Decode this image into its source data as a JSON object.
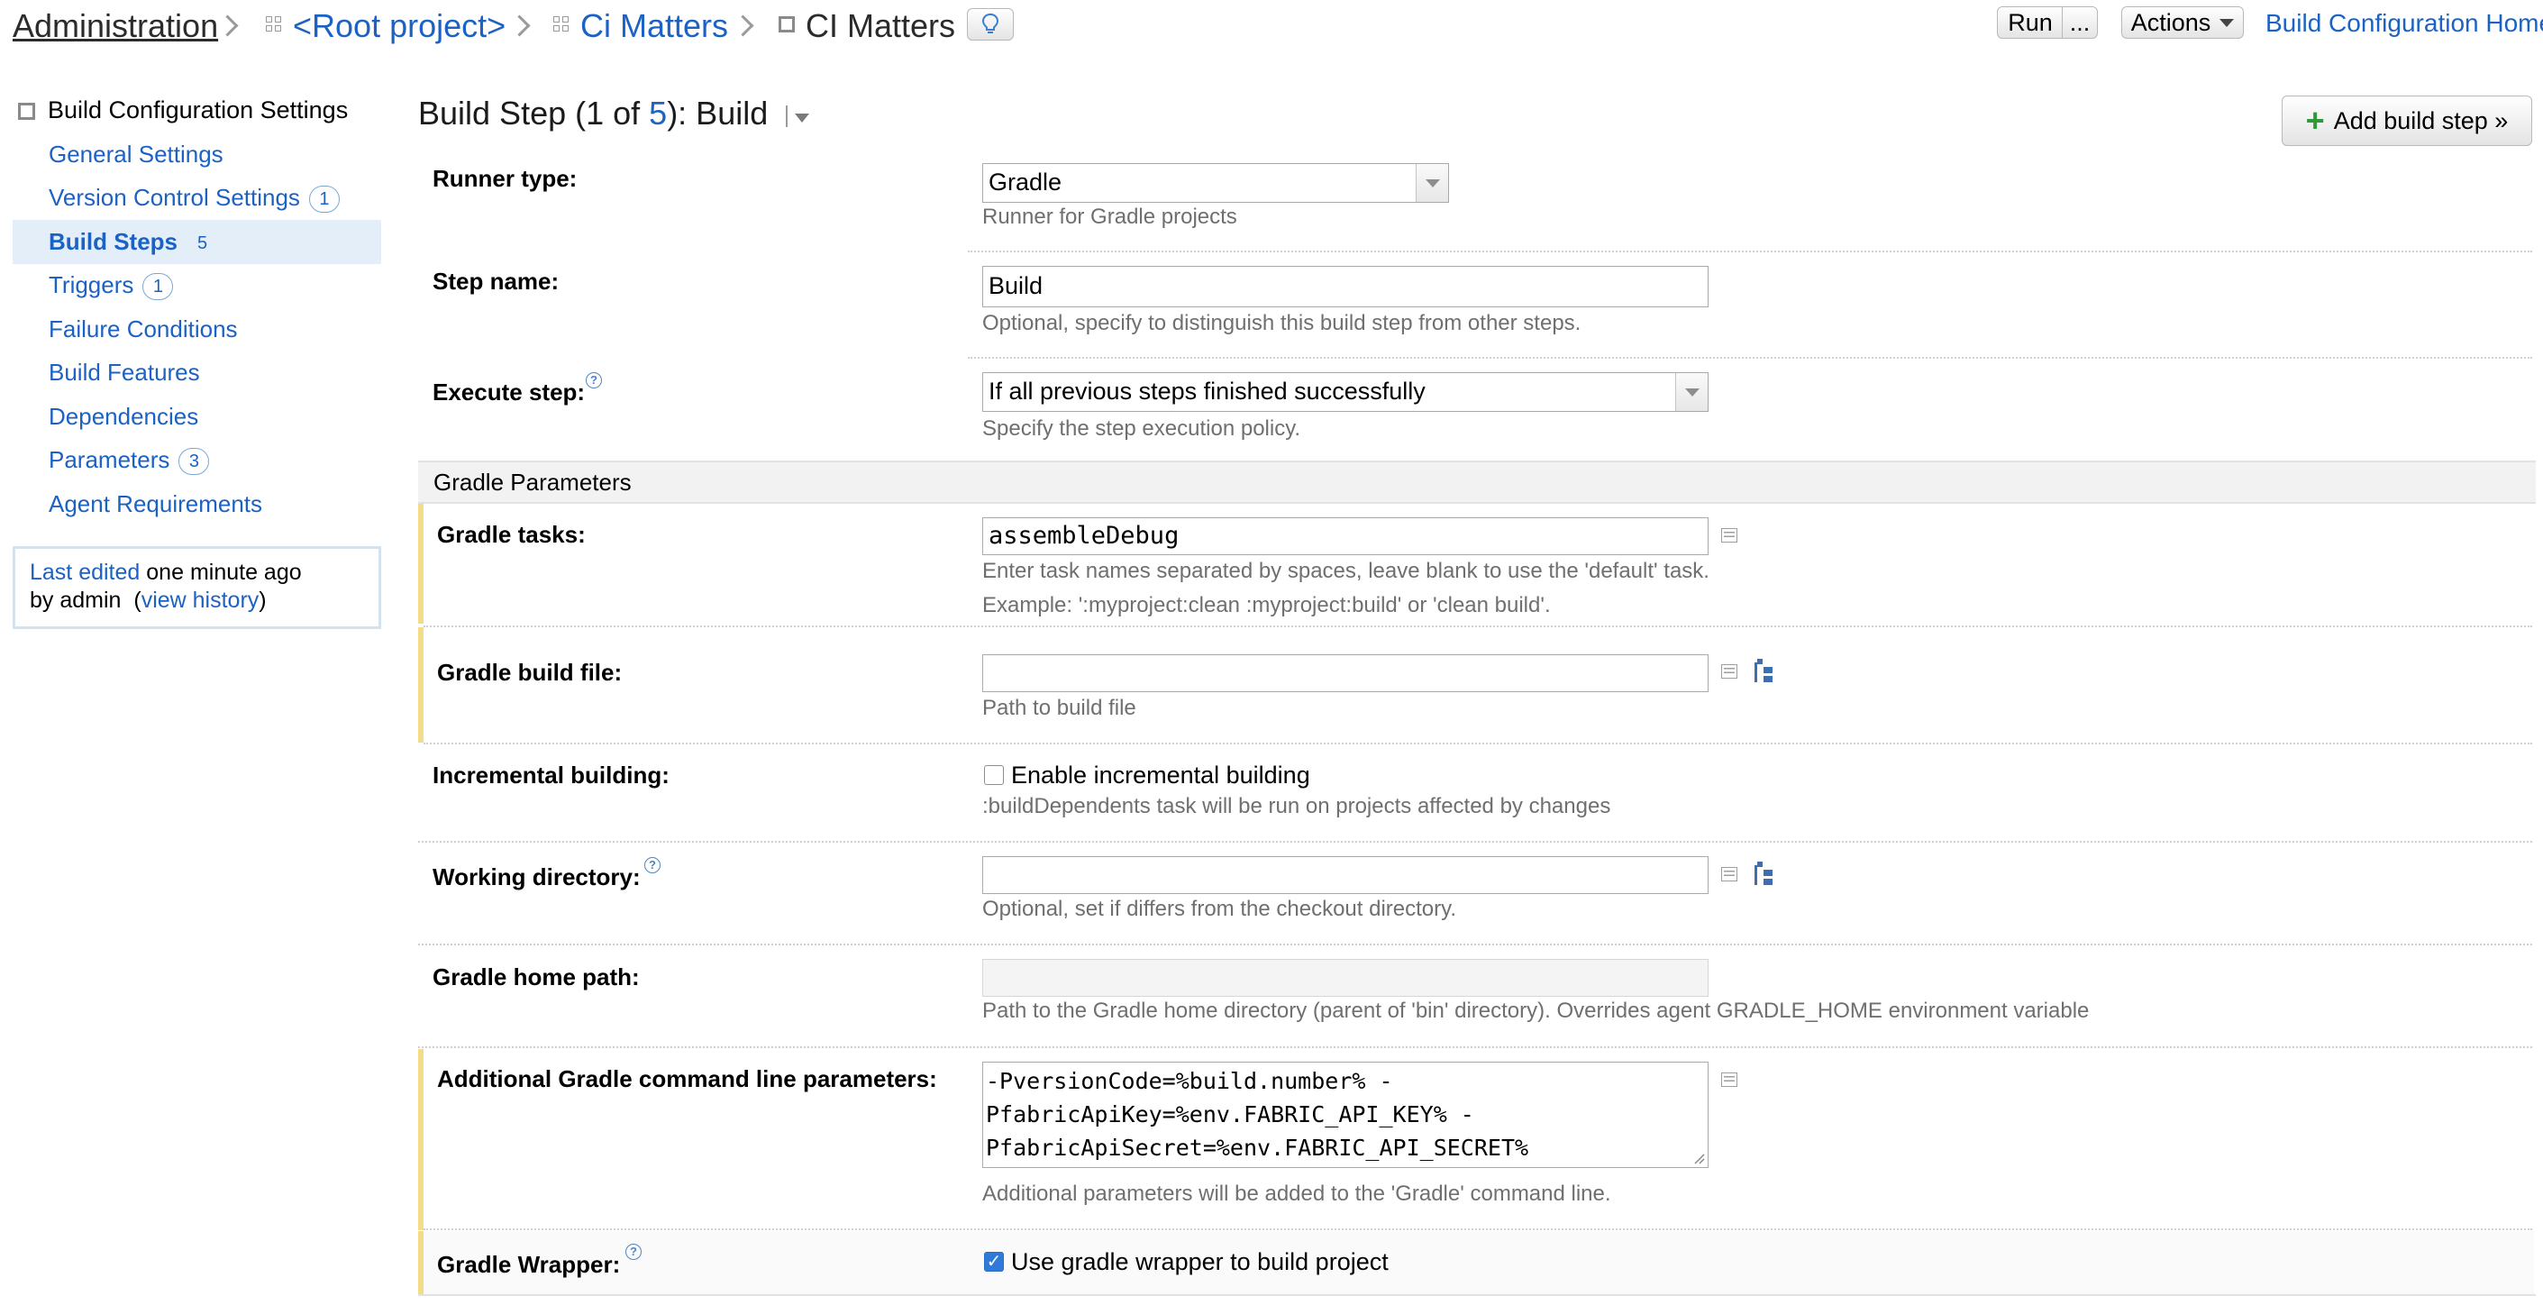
{
  "breadcrumb": {
    "admin": "Administration",
    "root": "<Root project>",
    "project": "Ci Matters",
    "config": "CI Matters"
  },
  "topbar": {
    "run_label": "Run",
    "more_label": "...",
    "actions_label": "Actions",
    "home_link": "Build Configuration Home"
  },
  "sidebar": {
    "section_title": "Build Configuration Settings",
    "items": [
      {
        "label": "General Settings",
        "badge": ""
      },
      {
        "label": "Version Control Settings",
        "badge": "1"
      },
      {
        "label": "Build Steps",
        "badge": "5"
      },
      {
        "label": "Triggers",
        "badge": "1"
      },
      {
        "label": "Failure Conditions",
        "badge": ""
      },
      {
        "label": "Build Features",
        "badge": ""
      },
      {
        "label": "Dependencies",
        "badge": ""
      },
      {
        "label": "Parameters",
        "badge": "3"
      },
      {
        "label": "Agent Requirements",
        "badge": ""
      }
    ],
    "edit": {
      "last_edited_link": "Last edited",
      "time_text": "one minute ago",
      "by_text": "by admin",
      "open_paren": "(",
      "view_history": "view history",
      "close_paren": ")"
    }
  },
  "header": {
    "title_prefix": "Build Step (1 of ",
    "title_count": "5",
    "title_suffix": "): Build",
    "add_button": "Add build step »"
  },
  "form": {
    "runner_type": {
      "label": "Runner type:",
      "value": "Gradle",
      "hint": "Runner for Gradle projects"
    },
    "step_name": {
      "label": "Step name:",
      "value": "Build",
      "hint": "Optional, specify to distinguish this build step from other steps."
    },
    "execute_step": {
      "label": "Execute step:",
      "value": "If all previous steps finished successfully",
      "hint": "Specify the step execution policy."
    },
    "section_title": "Gradle Parameters",
    "gradle_tasks": {
      "label": "Gradle tasks:",
      "value": "assembleDebug",
      "hint1": "Enter task names separated by spaces, leave blank to use the 'default' task.",
      "hint2": "Example: ':myproject:clean :myproject:build' or 'clean build'."
    },
    "build_file": {
      "label": "Gradle build file:",
      "value": "",
      "hint": "Path to build file"
    },
    "incremental": {
      "label": "Incremental building:",
      "checkbox_label": "Enable incremental building",
      "checked": false,
      "hint": ":buildDependents task will be run on projects affected by changes"
    },
    "working_dir": {
      "label": "Working directory:",
      "value": "",
      "hint": "Optional, set if differs from the checkout directory."
    },
    "gradle_home": {
      "label": "Gradle home path:",
      "value": "",
      "hint": "Path to the Gradle home directory (parent of 'bin' directory). Overrides agent GRADLE_HOME environment variable"
    },
    "cmd_params": {
      "label": "Additional Gradle command line parameters:",
      "line1": "-PversionCode=%build.number% -",
      "line2": "PfabricApiKey=%env.FABRIC_API_KEY% -",
      "line3": "PfabricApiSecret=%env.FABRIC_API_SECRET%",
      "hint": "Additional parameters will be added to the 'Gradle' command line."
    },
    "wrapper": {
      "label": "Gradle Wrapper:",
      "checkbox_label": "Use gradle wrapper to build project",
      "checked": true
    }
  },
  "colors": {
    "link": "#1c62c4",
    "selected_bg": "#e3eef9",
    "highlight_bar": "#f2dc8a"
  }
}
